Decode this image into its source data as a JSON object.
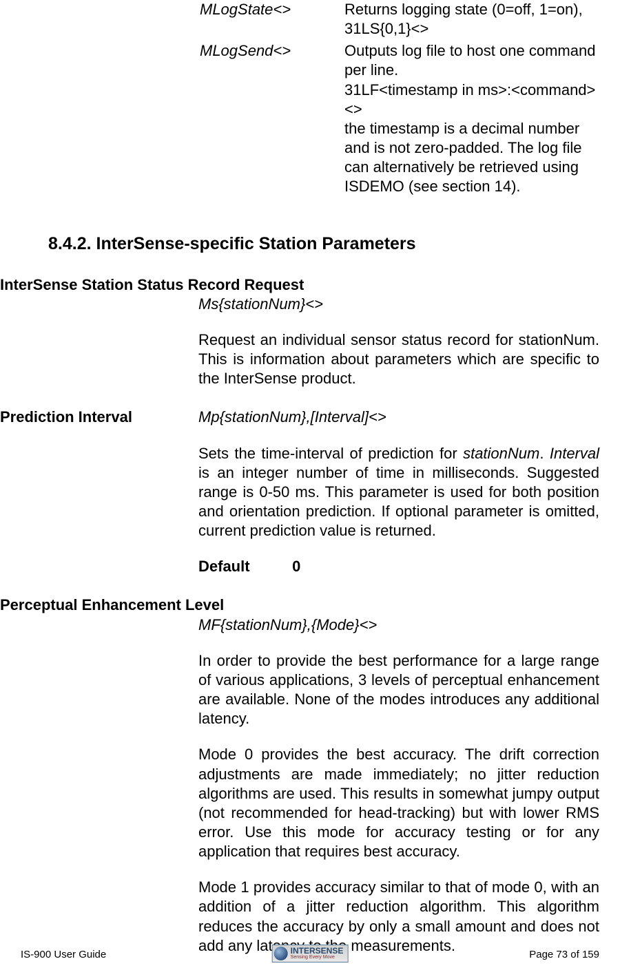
{
  "top_commands": [
    {
      "name": "MLogState<>",
      "desc": "Returns logging state (0=off, 1=on), 31LS{0,1}<>"
    },
    {
      "name": "MLogSend<>",
      "desc": "Outputs log file to host one command per line.\n31LF<timestamp in ms>:<command><>\nthe timestamp is a decimal number and is not zero-padded. The log file can alternatively be retrieved using ISDEMO (see section 14)."
    }
  ],
  "section_heading": "8.4.2. InterSense-specific Station Parameters",
  "status_record": {
    "title": "InterSense Station Status Record Request",
    "syntax": "Ms{stationNum}<>",
    "body": "Request an individual sensor status record for stationNum. This is information about parameters which are specific to the InterSense product."
  },
  "prediction": {
    "title": "Prediction Interval",
    "syntax": "Mp{stationNum},[Interval]<>",
    "body_pre": "Sets the time-interval of prediction for ",
    "body_em1": "stationNum",
    "body_mid": ".  ",
    "body_em2": "Interval",
    "body_post": " is an integer number of time in milliseconds.  Suggested range is 0-50 ms.  This parameter is used for both position and orientation prediction. If optional parameter is omitted, current prediction value is returned.",
    "default_label": "Default",
    "default_value": "0"
  },
  "pel": {
    "title": "Perceptual Enhancement Level",
    "syntax": "MF{stationNum},{Mode}<>",
    "p1": "In order to provide the best performance for a large range of various applications, 3 levels of perceptual enhancement are available.  None of the modes introduces any additional latency.",
    "p2": "Mode 0 provides the best accuracy.  The drift correction adjustments are made immediately; no jitter reduction algorithms are used.  This results in somewhat jumpy output (not recommended for head-tracking) but with lower RMS error.  Use this mode for accuracy testing or for any application that requires best accuracy.",
    "p3": "Mode 1 provides accuracy similar to that of mode 0, with an addition of a jitter reduction algorithm.  This algorithm reduces the accuracy by only a small amount and does not add any latency to the measurements."
  },
  "footer": {
    "left": "IS-900 User Guide",
    "right": "Page 73 of 159",
    "logo_top": "INTERSENSE",
    "logo_sub": "Sensing Every Move"
  }
}
